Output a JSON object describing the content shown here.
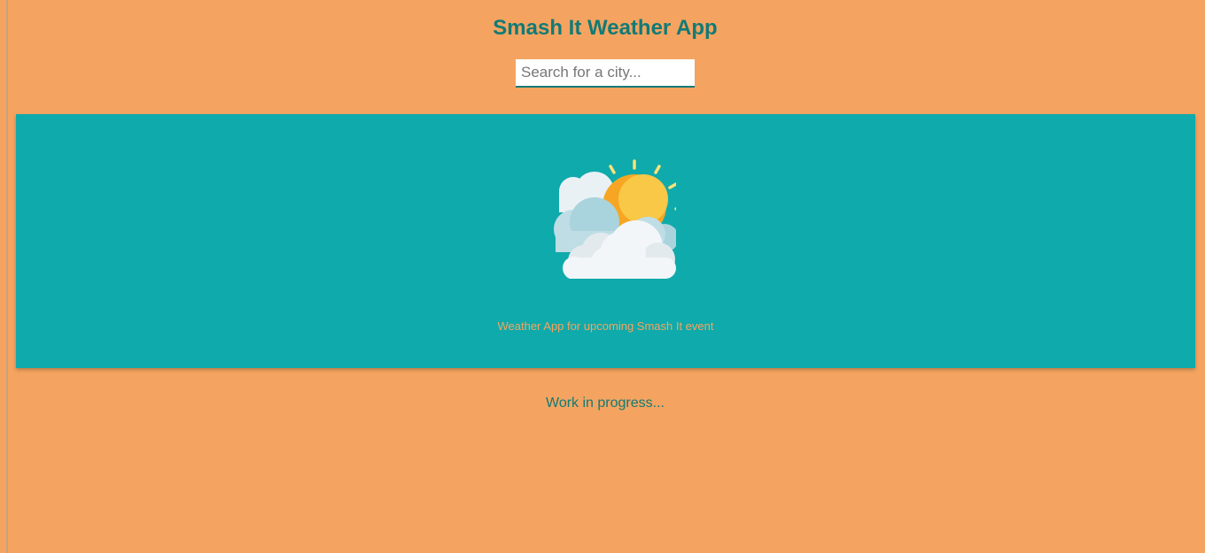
{
  "app": {
    "title": "Smash It Weather App"
  },
  "search": {
    "placeholder": "Search for a city...",
    "value": ""
  },
  "hero": {
    "illustration_icon": "partly-cloudy-sun-icon",
    "tagline": "Weather App for upcoming Smash It event"
  },
  "status": {
    "message": "Work in progress..."
  },
  "colors": {
    "background": "#f4a460",
    "card": "#0faaab",
    "title": "#127a76",
    "sun": "#f6b93b",
    "cloud": "#eef3f6"
  }
}
